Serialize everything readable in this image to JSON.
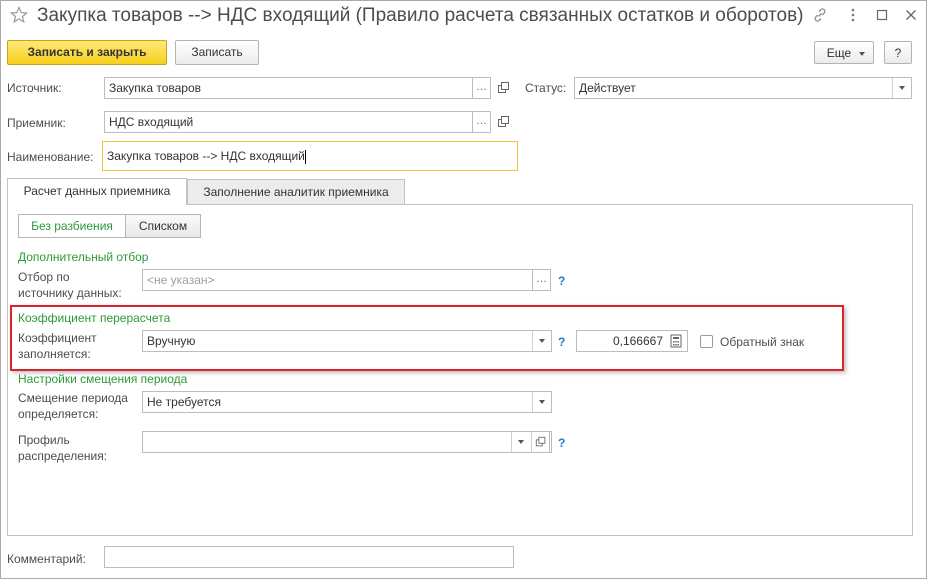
{
  "window": {
    "title": "Закупка товаров --> НДС входящий (Правило расчета связанных остатков и оборотов)"
  },
  "toolbar": {
    "save_close_label": "Записать и закрыть",
    "save_label": "Записать",
    "more_label": "Еще",
    "help_label": "?"
  },
  "header": {
    "source_label": "Источник:",
    "source_value": "Закупка товаров",
    "status_label": "Статус:",
    "status_value": "Действует",
    "receiver_label": "Приемник:",
    "receiver_value": "НДС входящий",
    "name_label": "Наименование:",
    "name_value": "Закупка товаров --> НДС входящий"
  },
  "tabs": [
    {
      "label": "Расчет данных приемника"
    },
    {
      "label": "Заполнение аналитик приемника"
    }
  ],
  "panel": {
    "segments": [
      "Без разбиения",
      "Списком"
    ],
    "extra_filter_title": "Дополнительный отбор",
    "filter_label_1": "Отбор по",
    "filter_label_2": "источнику данных:",
    "filter_placeholder": "<не указан>",
    "coef_title": "Коэффициент перерасчета",
    "coef_label_1": "Коэффициент",
    "coef_label_2": "заполняется:",
    "coef_mode": "Вручную",
    "coef_value": "0,166667",
    "reverse_sign_label": "Обратный знак",
    "period_title": "Настройки смещения периода",
    "shift_label_1": "Смещение периода",
    "shift_label_2": "определяется:",
    "shift_value": "Не требуется",
    "profile_label_1": "Профиль",
    "profile_label_2": "распределения:",
    "profile_value": "",
    "help_mark": "?"
  },
  "footer": {
    "comment_label": "Комментарий:",
    "comment_value": ""
  },
  "colors": {
    "primary_button": "#f7cf1c",
    "group_title": "#2e9a3a",
    "help_mark": "#1e7ad6",
    "highlight_frame": "#d9232d",
    "focus_border": "#f0c63c"
  },
  "icons": [
    "star-icon",
    "link-icon",
    "more-vertical-icon",
    "maximize-icon",
    "close-icon",
    "open-icon",
    "calculator-icon",
    "dropdown-arrow-icon",
    "ellipsis-icon"
  ]
}
